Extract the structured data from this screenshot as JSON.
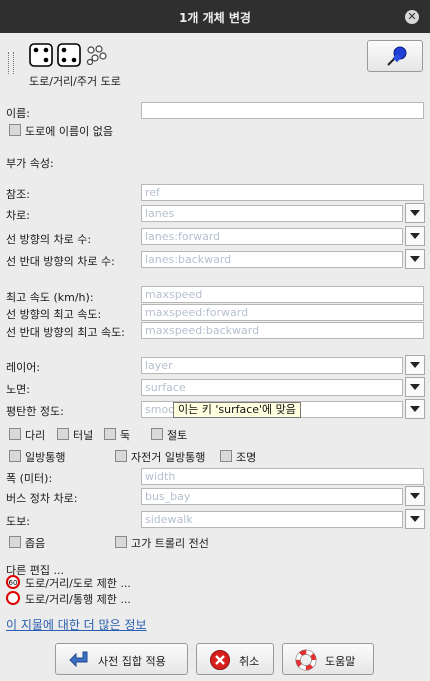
{
  "window": {
    "title": "1개 개체 변경"
  },
  "preset": {
    "name": "도로/거리/주거 도로"
  },
  "fields": {
    "name": {
      "label": "이름:",
      "value": ""
    },
    "noname": {
      "label": "도로에 이름이 없음"
    },
    "extra_header": "부가 속성:",
    "ref": {
      "label": "참조:",
      "placeholder": "ref"
    },
    "lanes": {
      "label": "차로:",
      "placeholder": "lanes"
    },
    "lanes_forward": {
      "label": "선 방향의 차로 수:",
      "placeholder": "lanes:forward"
    },
    "lanes_backward": {
      "label": "선 반대 방향의 차로 수:",
      "placeholder": "lanes:backward"
    },
    "maxspeed": {
      "label": "최고 속도 (km/h):",
      "placeholder": "maxspeed"
    },
    "maxspeed_forward": {
      "label": "선 방향의 최고 속도:",
      "placeholder": "maxspeed:forward"
    },
    "maxspeed_backward": {
      "label": "선 반대 방향의 최고 속도:",
      "placeholder": "maxspeed:backward"
    },
    "layer": {
      "label": "레이어:",
      "placeholder": "layer"
    },
    "surface": {
      "label": "노면:",
      "placeholder": "surface"
    },
    "smoothness": {
      "label": "평탄한 정도:",
      "placeholder": "smoo"
    },
    "width": {
      "label": "폭 (미터):",
      "placeholder": "width"
    },
    "bus_bay": {
      "label": "버스 정차 차로:",
      "placeholder": "bus_bay"
    },
    "sidewalk": {
      "label": "도보:",
      "placeholder": "sidewalk"
    }
  },
  "checkboxes": {
    "bridge": "다리",
    "tunnel": "터널",
    "embankment": "둑",
    "cutting": "절토",
    "oneway": "일방통행",
    "oneway_bicycle": "자전거 일방통행",
    "lit": "조명",
    "narrow": "좁음",
    "overhead_trolley": "고가 트롤리 전선"
  },
  "tooltip": "이는 키 'surface'에 맞음",
  "other_edits": {
    "header": "다른 편집 ...",
    "items": [
      "도로/거리/도로 제한 ...",
      "도로/거리/통행 제한 ..."
    ],
    "speed_sign": "60"
  },
  "more_info_link": "이 지물에 대한 더 많은 정보",
  "buttons": {
    "apply": "사전 집합 적용",
    "cancel": "취소",
    "help": "도움말"
  }
}
